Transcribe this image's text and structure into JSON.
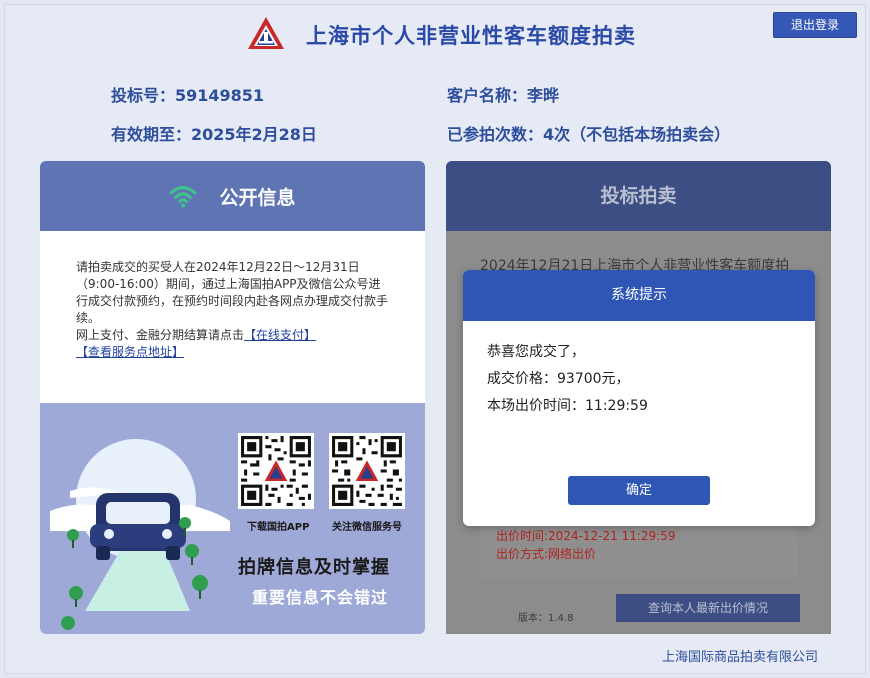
{
  "header": {
    "title": "上海市个人非营业性客车额度拍卖",
    "logout_label": "退出登录"
  },
  "info": {
    "bid_no": "投标号：59149851",
    "customer": "客户名称：李晔",
    "valid_until": "有效期至：2025年2月28日",
    "auction_count": "已参拍次数：4次（不包括本场拍卖会）"
  },
  "public_panel": {
    "title": "公开信息",
    "notice": "请拍卖成交的买受人在2024年12月22日～12月31日（9:00-16:00）期间，通过上海国拍APP及微信公众号进行成交付款预约，在预约时间段内赴各网点办理成交付款手续。",
    "online_text": "网上支付、金融分期结算请点击",
    "online_link": "【在线支付】",
    "service_link": "【查看服务点地址】",
    "qr_app_caption": "下载国拍APP",
    "qr_wechat_caption": "关注微信服务号",
    "promo_title": "拍牌信息及时掌握",
    "promo_subtitle": "重要信息不会错过"
  },
  "bid_panel": {
    "title": "投标拍卖",
    "auction_heading": "2024年12月21日上海市个人非营业性客车额度拍",
    "bid_time": "出价时间:2024-12-21 11:29:59",
    "bid_method": "出价方式:网络出价",
    "version": "版本：1.4.8",
    "query_button": "查询本人最新出价情况"
  },
  "modal": {
    "title": "系统提示",
    "line1": "恭喜您成交了，",
    "line2": "成交价格：93700元，",
    "line3": "本场出价时间：11:29:59",
    "ok_label": "确定"
  },
  "footer": {
    "company": "上海国际商品拍卖有限公司"
  },
  "colors": {
    "brand_blue": "#2b4aa8",
    "modal_blue": "#2f56b4",
    "panel_header": "#5f74b3",
    "bid_red": "#b0231f"
  },
  "icons": [
    "logo-icon",
    "wifi-icon",
    "qr-code-app",
    "qr-code-wechat",
    "car-illustration"
  ]
}
